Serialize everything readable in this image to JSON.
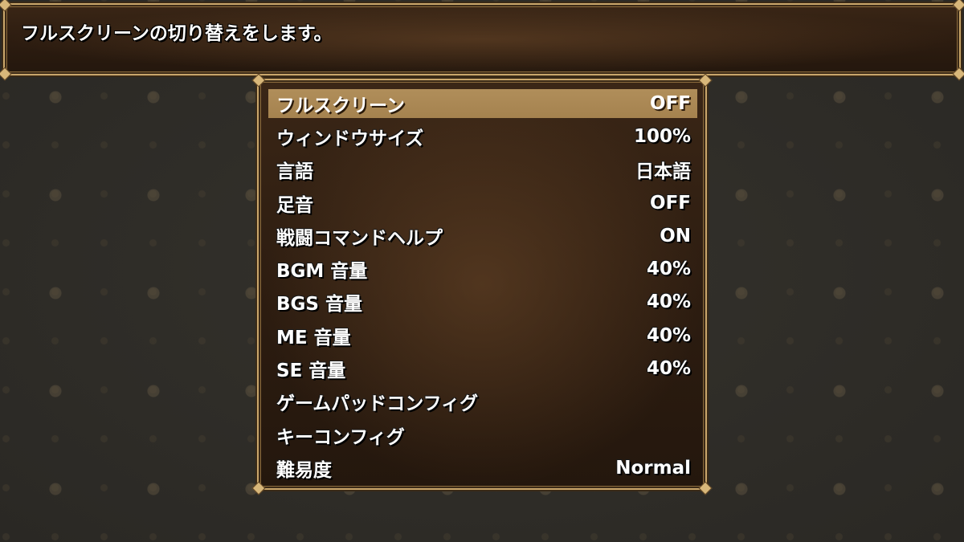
{
  "help": {
    "text": "フルスクリーンの切り替えをします。"
  },
  "options": {
    "selected_index": 0,
    "items": [
      {
        "label": "フルスクリーン",
        "value": "OFF"
      },
      {
        "label": "ウィンドウサイズ",
        "value": "100%"
      },
      {
        "label": "言語",
        "value": "日本語"
      },
      {
        "label": "足音",
        "value": "OFF"
      },
      {
        "label": "戦闘コマンドヘルプ",
        "value": "ON"
      },
      {
        "label": "BGM 音量",
        "value": "40%"
      },
      {
        "label": "BGS 音量",
        "value": "40%"
      },
      {
        "label": "ME 音量",
        "value": "40%"
      },
      {
        "label": "SE 音量",
        "value": "40%"
      },
      {
        "label": "ゲームパッドコンフィグ",
        "value": ""
      },
      {
        "label": "キーコンフィグ",
        "value": ""
      },
      {
        "label": "難易度",
        "value": "Normal"
      }
    ]
  },
  "colors": {
    "frame_gold": "#c9a66b",
    "window_brown": "#2c1c10",
    "selection": "#b08e5a",
    "text": "#ffffff"
  }
}
